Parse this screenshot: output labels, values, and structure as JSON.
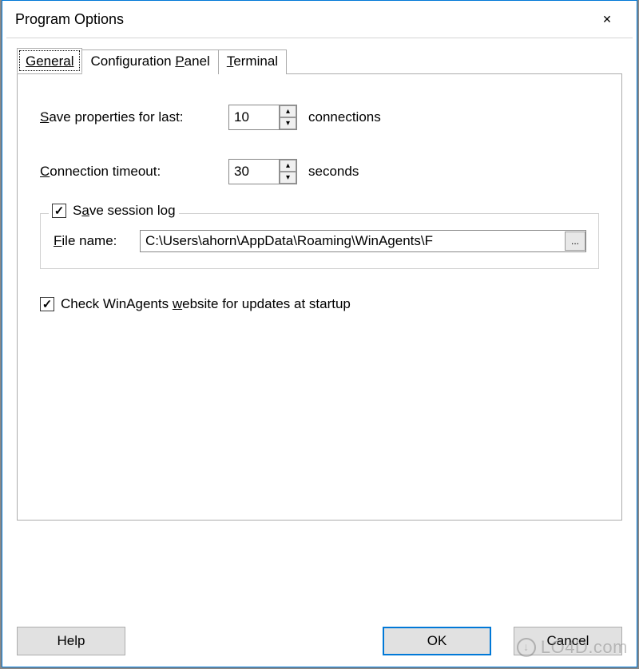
{
  "window": {
    "title": "Program Options"
  },
  "tabs": {
    "general": "General",
    "configPanel_pre": "Configuration ",
    "configPanel_u": "P",
    "configPanel_post": "anel",
    "terminal_u": "T",
    "terminal_post": "erminal"
  },
  "general": {
    "save_u": "S",
    "save_post": "ave properties for last:",
    "save_value": "10",
    "save_suffix": "connections",
    "timeout_u": "C",
    "timeout_post": "onnection timeout:",
    "timeout_value": "30",
    "timeout_suffix": "seconds",
    "savelog_pre": "S",
    "savelog_u": "a",
    "savelog_post": "ve session log",
    "filename_u": "F",
    "filename_post": "ile name:",
    "filename_value": "C:\\Users\\ahorn\\AppData\\Roaming\\WinAgents\\F",
    "browse_label": "...",
    "updates_pre": "Check WinAgents ",
    "updates_u": "w",
    "updates_post": "ebsite for updates at startup"
  },
  "buttons": {
    "help": "Help",
    "ok": "OK",
    "cancel": "Cancel"
  },
  "watermark": "LO4D.com"
}
